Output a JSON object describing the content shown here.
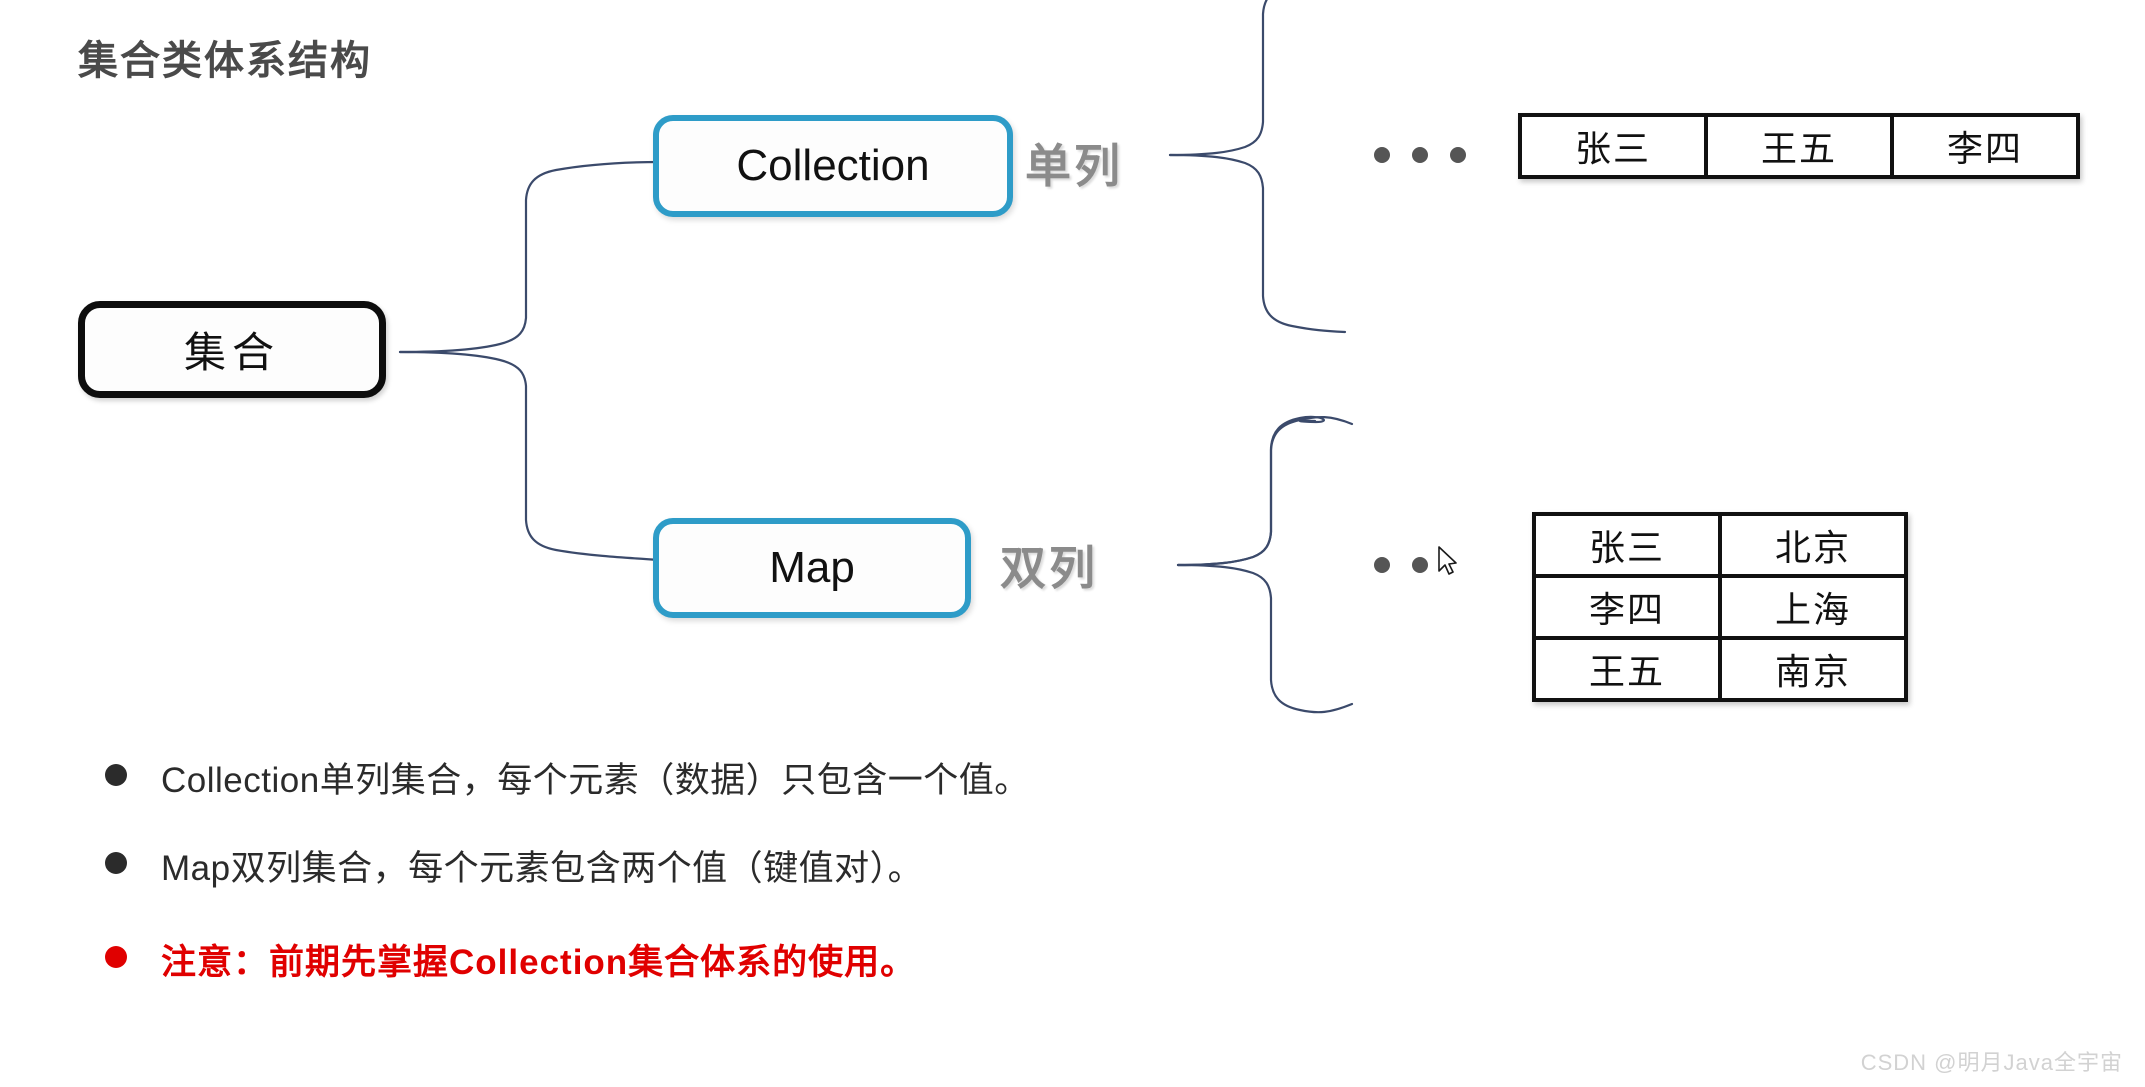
{
  "slide": {
    "title": "集合类体系结构",
    "background_color": "#ffffff"
  },
  "diagram": {
    "root_node": {
      "label": "集合",
      "border_color": "#0d0d0d"
    },
    "branches": [
      {
        "node_label": "Collection",
        "side_label": "单列",
        "node_border_color": "#2e9cc8",
        "ellipsis": "…",
        "table": {
          "kind": "single-column-collection",
          "rows": [
            [
              "张三",
              "王五",
              "李四"
            ]
          ]
        }
      },
      {
        "node_label": "Map",
        "side_label": "双列",
        "node_border_color": "#2e9cc8",
        "ellipsis": "…",
        "table": {
          "kind": "key-value-map",
          "rows": [
            [
              "张三",
              "北京"
            ],
            [
              "李四",
              "上海"
            ],
            [
              "王五",
              "南京"
            ]
          ]
        }
      }
    ],
    "connector_color": "#3b4a6b"
  },
  "bullets": [
    {
      "text": "Collection单列集合，每个元素（数据）只包含一个值。",
      "color": "#2b2b2b",
      "emphasis": false
    },
    {
      "text": "Map双列集合，每个元素包含两个值（键值对）。",
      "color": "#2b2b2b",
      "emphasis": false
    },
    {
      "text": "注意：前期先掌握Collection集合体系的使用。",
      "color": "#e00000",
      "emphasis": true
    }
  ],
  "watermark": {
    "text": "CSDN @明月Java全宇宙",
    "color": "#d2d2d2"
  }
}
